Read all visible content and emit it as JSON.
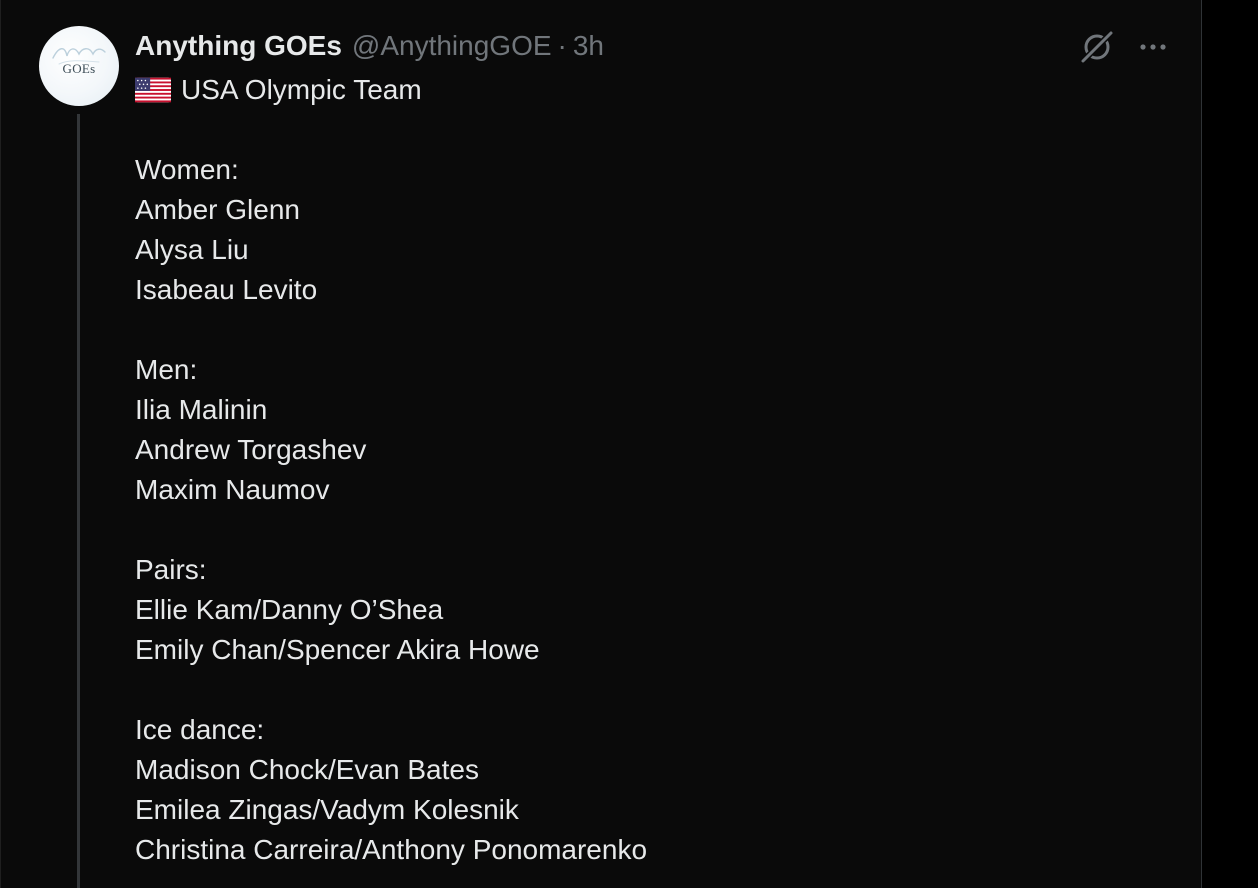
{
  "tweet": {
    "display_name": "Anything GOEs",
    "handle": "@AnythingGOE",
    "separator": "·",
    "time": "3h",
    "avatar_text": "GOEs",
    "avatar_script": "anything",
    "flag_icon": "us-flag-icon",
    "title_line": "USA Olympic Team",
    "sections": [
      {
        "heading": "Women:",
        "entries": [
          "Amber Glenn",
          "Alysa Liu",
          "Isabeau Levito"
        ]
      },
      {
        "heading": "Men:",
        "entries": [
          "Ilia Malinin",
          "Andrew Torgashev",
          "Maxim Naumov"
        ]
      },
      {
        "heading": "Pairs:",
        "entries": [
          "Ellie Kam/Danny O’Shea",
          "Emily Chan/Spencer Akira Howe"
        ]
      },
      {
        "heading": "Ice dance:",
        "entries": [
          "Madison Chock/Evan Bates",
          "Emilea Zingas/Vadym Kolesnik",
          "Christina Carreira/Anthony Ponomarenko"
        ]
      }
    ]
  },
  "actions": {
    "grok_icon": "grok-icon",
    "more_icon": "more-options-icon"
  },
  "colors": {
    "background": "#000000",
    "primary_text": "#e7e9ea",
    "secondary_text": "#71767b",
    "thread_line": "#333639"
  }
}
